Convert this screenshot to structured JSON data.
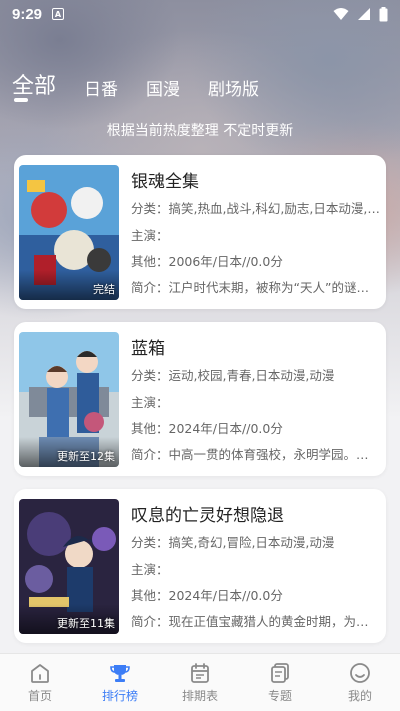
{
  "status": {
    "time": "9:29",
    "a_badge": "A"
  },
  "tabs": [
    {
      "label": "全部"
    },
    {
      "label": "日番"
    },
    {
      "label": "国漫"
    },
    {
      "label": "剧场版"
    }
  ],
  "subtitle": "根据当前热度整理 不定时更新",
  "cards": [
    {
      "title": "银魂全集",
      "tag": "完结",
      "genre": "分类：搞笑,热血,战斗,科幻,励志,日本动漫,动漫",
      "cast": "主演：",
      "other": "其他：2006年/日本//0.0分",
      "intro": "简介：江户时代末期，被称为“天人”的谜之外星人来袭"
    },
    {
      "title": "蓝箱",
      "tag": "更新至12集",
      "genre": "分类：运动,校园,青春,日本动漫,动漫",
      "cast": "主演：",
      "other": "其他：2024年/日本//0.0分",
      "intro": "简介：中高一贯的体育强校，永明学园。以羽毛球部的"
    },
    {
      "title": "叹息的亡灵好想隐退",
      "tag": "更新至11集",
      "genre": "分类：搞笑,奇幻,冒险,日本动漫,动漫",
      "cast": "主演：",
      "other": "其他：2024年/日本//0.0分",
      "intro": "简介：现在正值宝藏猎人的黄金时期，为了追求宝藏"
    }
  ],
  "nav": [
    {
      "label": "首页",
      "icon": "home-icon"
    },
    {
      "label": "排行榜",
      "icon": "trophy-icon"
    },
    {
      "label": "排期表",
      "icon": "calendar-icon"
    },
    {
      "label": "专题",
      "icon": "topic-icon"
    },
    {
      "label": "我的",
      "icon": "profile-icon"
    }
  ],
  "colors": {
    "accent": "#3c7df6",
    "inactive": "#8a8a8a"
  }
}
